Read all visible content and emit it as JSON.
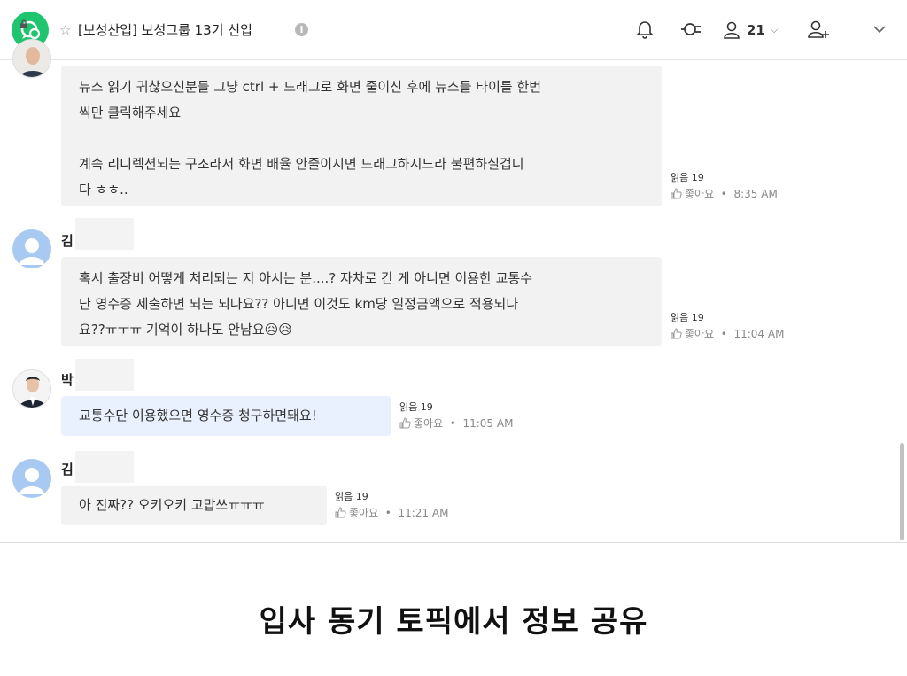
{
  "header": {
    "title": "[보성산업] 보성그룹 13기 신입",
    "member_count": "21"
  },
  "messages": [
    {
      "sender": "",
      "text": "뉴스 읽기 귀찮으신분들 그냥 ctrl + 드래그로 화면 줄이신 후에 뉴스들 타이틀 한번\n씩만 클릭해주세요\n\n계속 리디렉션되는 구조라서 화면 배율 안줄이시면 드래그하시느라 불편하실겁니\n다 ㅎㅎ..",
      "read": "읽음 19",
      "like": "좋아요",
      "time": "8:35 AM"
    },
    {
      "sender": "김",
      "text": "혹시 출장비 어떻게 처리되는 지 아시는 분....? 자차로 간 게 아니면 이용한 교통수\n단 영수증 제출하면 되는 되나요?? 아니면 이것도 km당 일정금액으로 적용되나\n요??ㅠㅜㅠ 기억이 하나도 안남요😥😥",
      "read": "읽음 19",
      "like": "좋아요",
      "time": "11:04 AM"
    },
    {
      "sender": "박",
      "text": "교통수단 이용했으면 영수증 청구하면돼요!",
      "read": "읽음 19",
      "like": "좋아요",
      "time": "11:05 AM"
    },
    {
      "sender": "김",
      "text": "아 진짜?? 오키오키 고맙쓰ㅠㅠㅠ",
      "read": "읽음 19",
      "like": "좋아요",
      "time": "11:21 AM"
    }
  ],
  "caption": "입사 동기 토픽에서 정보 공유",
  "colors": {
    "brand": "#1fc46e",
    "bubble": "#f2f2f2",
    "bubble_mine": "#e8f1fd"
  }
}
